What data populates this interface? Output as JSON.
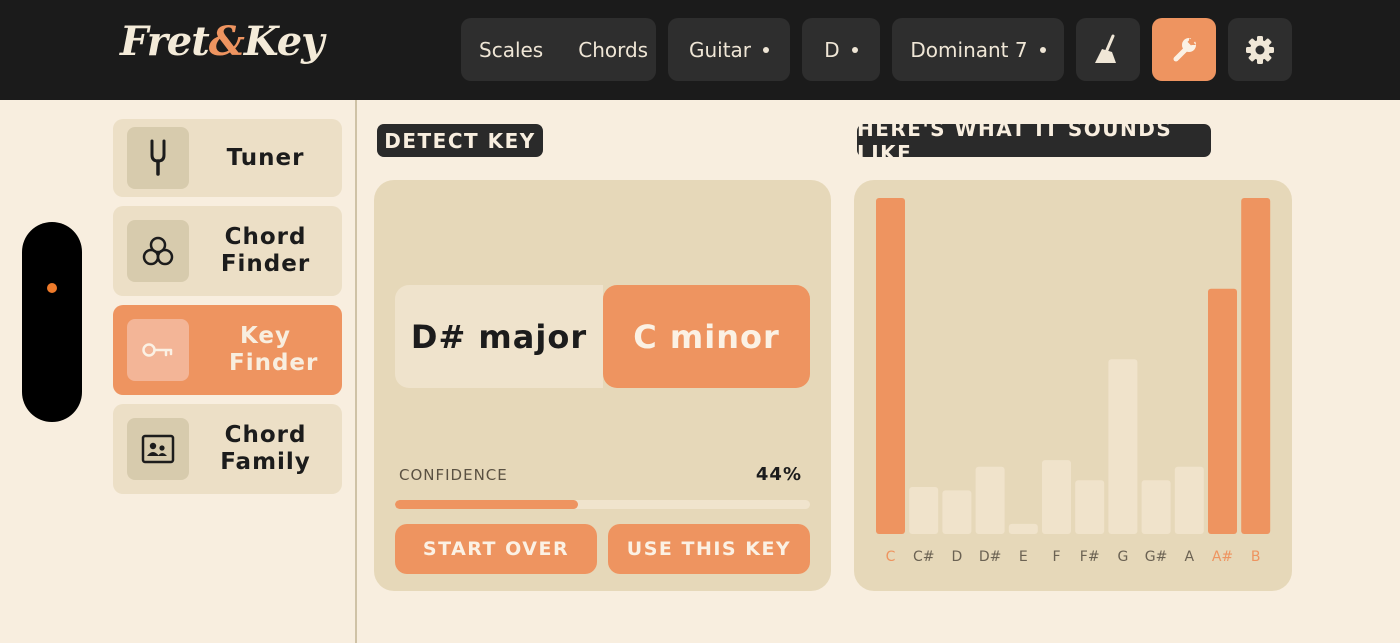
{
  "app": {
    "logo_part1": "Fret",
    "logo_amp": "&",
    "logo_part2": "Key"
  },
  "header": {
    "segment": [
      "Scales",
      "Chords"
    ],
    "instrument": "Guitar",
    "root": "D",
    "chord_type": "Dominant 7",
    "icons": [
      "broom-icon",
      "wrench-icon",
      "gear-icon"
    ],
    "active_icon": "wrench-icon"
  },
  "sidebar": {
    "items": [
      {
        "label": "Tuner",
        "icon": "tuning-fork-icon",
        "active": false
      },
      {
        "label": "Chord Finder",
        "icon": "circles-icon",
        "active": false
      },
      {
        "label": "Key Finder",
        "icon": "key-icon",
        "active": true
      },
      {
        "label": "Chord Family",
        "icon": "contact-card-icon",
        "active": false
      }
    ]
  },
  "detect": {
    "title": "DETECT KEY",
    "options": [
      "D# major",
      "C minor"
    ],
    "selected": "C minor",
    "confidence_label": "CONFIDENCE",
    "confidence_text": "44%",
    "confidence": 0.44,
    "start_over": "START OVER",
    "use_key": "USE THIS KEY"
  },
  "sounds": {
    "title": "HERE'S WHAT IT SOUNDS LIKE"
  },
  "colors": {
    "accent": "#ee9460",
    "dark": "#1b1b1b",
    "background": "#f8eedf",
    "card": "#e6d8b9",
    "bar_muted": "#f0e3cb"
  },
  "chart_data": {
    "type": "bar",
    "categories": [
      "C",
      "C#",
      "D",
      "D#",
      "E",
      "F",
      "F#",
      "G",
      "G#",
      "A",
      "A#",
      "B"
    ],
    "values": [
      1.0,
      0.14,
      0.13,
      0.2,
      0.03,
      0.22,
      0.16,
      0.52,
      0.16,
      0.2,
      0.73,
      1.0
    ],
    "highlighted": [
      "C",
      "A#",
      "B"
    ],
    "ylim": [
      0,
      1
    ]
  }
}
